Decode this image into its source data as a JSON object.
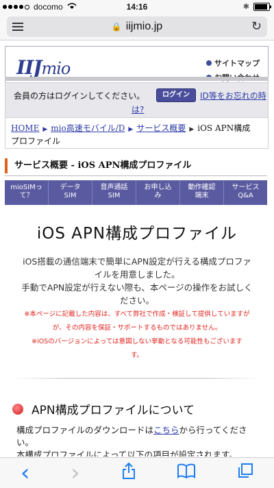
{
  "status": {
    "carrier": "docomo",
    "time": "14:16"
  },
  "browser": {
    "host": "iijmio.jp"
  },
  "header": {
    "logo_main": "IIJ",
    "logo_sub": "mio",
    "links": [
      "サイトマップ",
      "お問い合わせ"
    ]
  },
  "login": {
    "message": "会員の方はログインしてください。",
    "button": "ログイン",
    "forgot_line1": "ID等をお忘れの時",
    "forgot_line2": "は?"
  },
  "breadcrumb": {
    "items": [
      "HOME",
      "mio高速モバイル/D",
      "サービス概要"
    ],
    "current_line1": "iOS APN構成",
    "current_line2": "プロファイル"
  },
  "section_title": "サービス概要 - iOS APN構成プロファイル",
  "nav": {
    "items": [
      {
        "l1": "mioSIMっ",
        "l2": "て？"
      },
      {
        "l1": "データ",
        "l2": "SIM"
      },
      {
        "l1": "音声通話",
        "l2": "SIM"
      },
      {
        "l1": "お申し込",
        "l2": "み"
      },
      {
        "l1": "動作確認",
        "l2": "端末"
      },
      {
        "l1": "サービス",
        "l2": "Q&A"
      }
    ]
  },
  "page_title": "iOS APN構成プロファイル",
  "intro": {
    "l1": "iOS搭載の通信端末で簡単にAPN設定が行える構成プロファ",
    "l2": "イルを用意しました。",
    "l3": "手動でAPN設定が行えない際も、本ページの操作をお試しく",
    "l4": "ださい。"
  },
  "notes": {
    "l1": "※本ページに記載した内容は、すべて弊社で作成・検証して提供していますが",
    "l2": "が、その内容を保証・サポートするものではありません。",
    "l3": "※iOSのバージョンによっては意図しない挙動となる可能性もございます",
    "l4": "す。"
  },
  "section2": {
    "heading": "APN構成プロファイルについて",
    "p1_a": "構成プロファイルのダウンロードは",
    "p1_link": "こちら",
    "p1_b": "から行ってくださ",
    "p1_c": "い。",
    "p2": "本構成プロファイルによって以下の項目が設定されます。"
  },
  "toolbar": {
    "back": "‹",
    "forward": "›"
  }
}
